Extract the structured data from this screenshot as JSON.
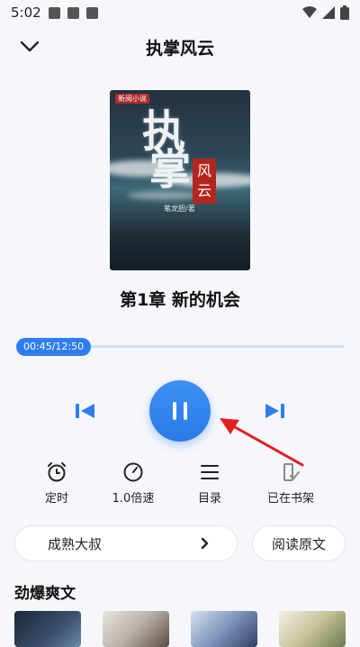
{
  "status": {
    "time": "5:02"
  },
  "header": {
    "title": "执掌风云"
  },
  "cover": {
    "publisher_tag": "新阅小说",
    "title_char_1": "执",
    "title_char_2": "掌",
    "title_char_3": "风",
    "title_char_4": "云",
    "author": "笔龙胆/著"
  },
  "chapter": {
    "title": "第1章  新的机会"
  },
  "progress": {
    "label": "00:45/12:50",
    "fraction": 0.058
  },
  "functions": [
    {
      "label": "定时",
      "icon": "alarm-clock-icon"
    },
    {
      "label": "1.0倍速",
      "icon": "speed-gauge-icon"
    },
    {
      "label": "目录",
      "icon": "menu-list-icon"
    },
    {
      "label": "已在书架",
      "icon": "bookshelf-check-icon"
    }
  ],
  "voice": {
    "label": "成熟大叔"
  },
  "read_original": {
    "label": "阅读原文"
  },
  "recommend": {
    "title": "劲爆爽文"
  },
  "colors": {
    "accent": "#2f7df0",
    "background": "#f5f7fb",
    "arrow": "#e02020"
  }
}
